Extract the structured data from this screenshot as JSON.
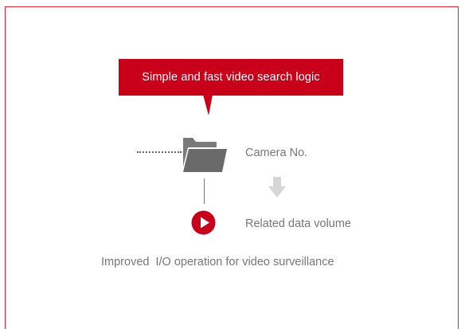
{
  "callout": {
    "text": "Simple and fast video search logic"
  },
  "labels": {
    "camera": "Camera No.",
    "related": "Related data volume",
    "improved": "Improved  I/O operation for video surveillance"
  },
  "icons": [
    "folder-icon",
    "play-icon",
    "down-arrow-icon"
  ],
  "colors": {
    "accent": "#c8001a",
    "border": "#e0202a",
    "text": "#777777",
    "icon_gray": "#6e6e6e"
  }
}
